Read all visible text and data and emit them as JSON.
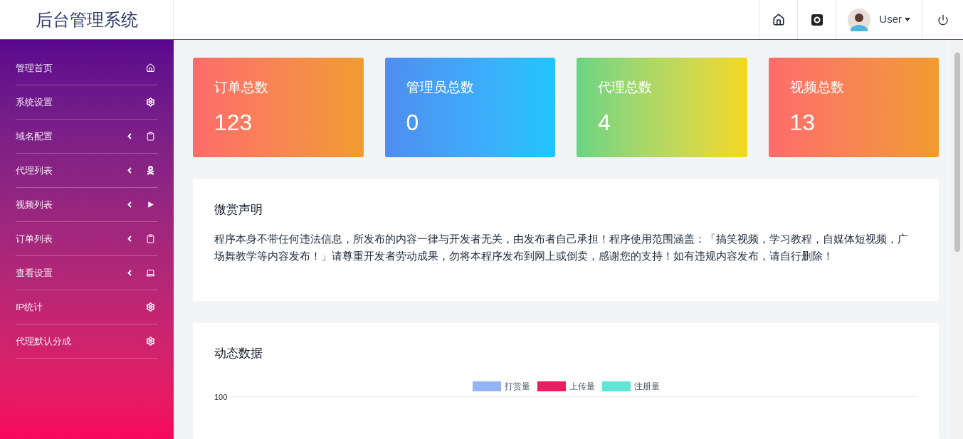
{
  "brand": "后台管理系统",
  "header": {
    "user": "User"
  },
  "sidebar": {
    "items": [
      {
        "label": "管理首页",
        "expandable": false
      },
      {
        "label": "系统设置",
        "expandable": false
      },
      {
        "label": "域名配置",
        "expandable": true
      },
      {
        "label": "代理列表",
        "expandable": true
      },
      {
        "label": "视频列表",
        "expandable": true
      },
      {
        "label": "订单列表",
        "expandable": true
      },
      {
        "label": "查看设置",
        "expandable": true
      },
      {
        "label": "IP统计",
        "expandable": false
      },
      {
        "label": "代理默认分成",
        "expandable": false
      }
    ]
  },
  "stats": [
    {
      "label": "订单总数",
      "value": "123"
    },
    {
      "label": "管理员总数",
      "value": "0"
    },
    {
      "label": "代理总数",
      "value": "4"
    },
    {
      "label": "视频总数",
      "value": "13"
    }
  ],
  "notice": {
    "title": "微赏声明",
    "text": "程序本身不带任何违法信息，所发布的内容一律与开发者无关，由发布者自己承担！程序使用范围涵盖：「搞笑视频，学习教程，自媒体短视频，广场舞教学等内容发布！」请尊重开发者劳动成果，勿将本程序发布到网上或倒卖，感谢您的支持！如有违规内容发布，请自行删除！"
  },
  "chart": {
    "title": "动态数据",
    "legend": [
      {
        "label": "打赏量",
        "color": "#93b5f5"
      },
      {
        "label": "上传量",
        "color": "#e91e63"
      },
      {
        "label": "注册量",
        "color": "#64e3d9"
      }
    ],
    "y_tick": "100"
  }
}
